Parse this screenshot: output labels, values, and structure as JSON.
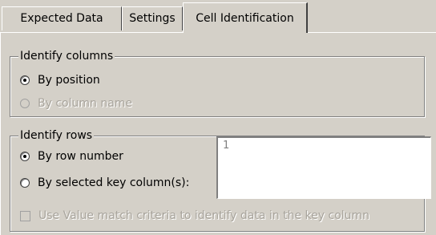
{
  "tabs": [
    {
      "label": "Expected Data"
    },
    {
      "label": "Settings"
    },
    {
      "label": "Cell Identification",
      "active": true
    }
  ],
  "identify_columns": {
    "legend": "Identify columns",
    "options": [
      {
        "label": "By position",
        "selected": true,
        "enabled": true
      },
      {
        "label": "By column name",
        "selected": false,
        "enabled": false
      }
    ]
  },
  "identify_rows": {
    "legend": "Identify rows",
    "options": [
      {
        "label": "By row number",
        "selected": true,
        "enabled": true
      },
      {
        "label": "By selected key column(s):",
        "selected": false,
        "enabled": true
      }
    ],
    "key_column_value": "1",
    "use_value_match": {
      "label": "Use Value match criteria to identify data in the key column",
      "checked": false,
      "enabled": false
    }
  },
  "colors": {
    "face": "#d4d0c8",
    "shadow": "#808080",
    "highlight": "#ffffff",
    "disabled_text": "#a8a49c"
  }
}
